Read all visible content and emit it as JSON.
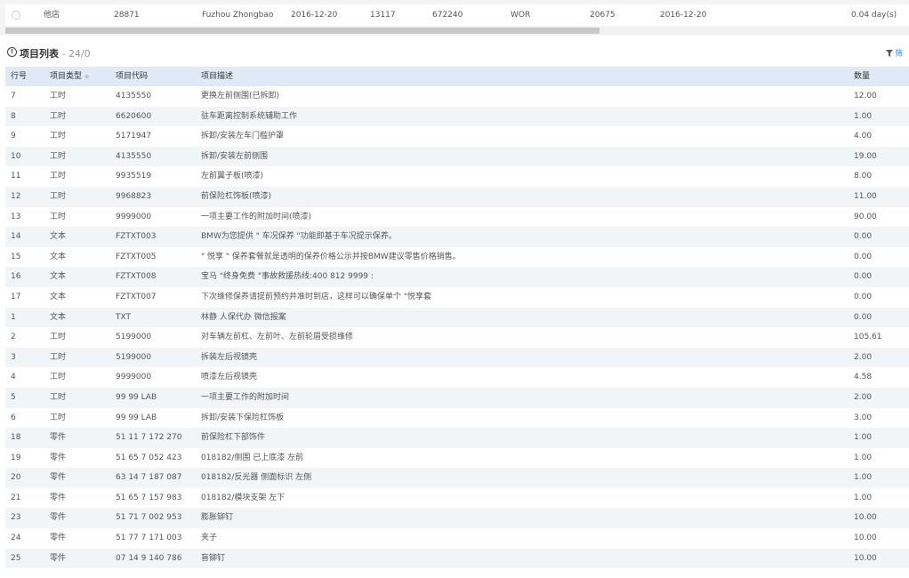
{
  "top_row": {
    "cells": [
      "他店",
      "28871",
      "Fuzhou Zhongbao",
      "2016-12-20",
      "13117",
      "672240",
      "WOR",
      "20675",
      "2016-12-20",
      "0.04 day(s)"
    ]
  },
  "section": {
    "title": "项目列表",
    "separator": " - ",
    "count": "24/0",
    "filter_label": "筛"
  },
  "table": {
    "headers": {
      "no": "行号",
      "type": "项目类型",
      "code": "项目代码",
      "desc": "项目描述",
      "qty": "数量"
    },
    "rows": [
      {
        "no": "7",
        "type": "工时",
        "code": "4135550",
        "desc": "更换左前侧围(已拆卸)",
        "qty": "12.00"
      },
      {
        "no": "8",
        "type": "工时",
        "code": "6620600",
        "desc": "驻车距离控制系统辅助工作",
        "qty": "1.00"
      },
      {
        "no": "9",
        "type": "工时",
        "code": "5171947",
        "desc": "拆卸/安装左车门槛护罩",
        "qty": "4.00"
      },
      {
        "no": "10",
        "type": "工时",
        "code": "4135550",
        "desc": "拆卸/安装左前侧围",
        "qty": "19.00"
      },
      {
        "no": "11",
        "type": "工时",
        "code": "9935519",
        "desc": "左前翼子板(喷漆)",
        "qty": "8.00"
      },
      {
        "no": "12",
        "type": "工时",
        "code": "9968823",
        "desc": "前保险杠饰板(喷漆)",
        "qty": "11.00"
      },
      {
        "no": "13",
        "type": "工时",
        "code": "9999000",
        "desc": "一项主要工作的附加时间(喷漆)",
        "qty": "90.00"
      },
      {
        "no": "14",
        "type": "文本",
        "code": "FZTXT003",
        "desc": "BMW为您提供 \" 车况保养 \"功能即基于车况提示保养。",
        "qty": "0.00"
      },
      {
        "no": "15",
        "type": "文本",
        "code": "FZTXT005",
        "desc": "\" 悦享 \" 保养套餐就是透明的保养价格公示并按BMW建议零售价格销售。",
        "qty": "0.00"
      },
      {
        "no": "16",
        "type": "文本",
        "code": "FZTXT008",
        "desc": "宝马 \"终身免费 \"事故救援热线:400 812 9999 :",
        "qty": "0.00"
      },
      {
        "no": "17",
        "type": "文本",
        "code": "FZTXT007",
        "desc": "下次维修保养请提前预约并准时到店，这样可以确保单个 \"悦享套",
        "qty": "0.00"
      },
      {
        "no": "1",
        "type": "文本",
        "code": "TXT",
        "desc": "林静 人保代办 微信报案",
        "qty": "0.00"
      },
      {
        "no": "2",
        "type": "工时",
        "code": "5199000",
        "desc": "对车辆左前杠、左前叶、左前轮眉受损维修",
        "qty": "105.61"
      },
      {
        "no": "3",
        "type": "工时",
        "code": "5199000",
        "desc": "拆装左后视镜壳",
        "qty": "2.00"
      },
      {
        "no": "4",
        "type": "工时",
        "code": "9999000",
        "desc": "喷漆左后视镜壳",
        "qty": "4.58"
      },
      {
        "no": "5",
        "type": "工时",
        "code": "99 99 LAB",
        "desc": "一项主要工作的附加时间",
        "qty": "2.00"
      },
      {
        "no": "6",
        "type": "工时",
        "code": "99 99 LAB",
        "desc": "拆卸/安装下保险杠饰板",
        "qty": "3.00"
      },
      {
        "no": "18",
        "type": "零件",
        "code": "51 11 7 172 270",
        "desc": "前保险杠下部饰件",
        "qty": "1.00"
      },
      {
        "no": "19",
        "type": "零件",
        "code": "51 65 7 052 423",
        "desc": "018182/侧围 已上底漆 左前",
        "qty": "1.00"
      },
      {
        "no": "20",
        "type": "零件",
        "code": "63 14 7 187 087",
        "desc": "018182/反光器 侧面标识 左侧",
        "qty": "1.00"
      },
      {
        "no": "21",
        "type": "零件",
        "code": "51 65 7 157 983",
        "desc": "018182/模块支架 左下",
        "qty": "1.00"
      },
      {
        "no": "23",
        "type": "零件",
        "code": "51 71 7 002 953",
        "desc": "膨胀铆钉",
        "qty": "10.00"
      },
      {
        "no": "24",
        "type": "零件",
        "code": "51 77 7 171 003",
        "desc": "夹子",
        "qty": "10.00"
      },
      {
        "no": "25",
        "type": "零件",
        "code": "07 14 9 140 786",
        "desc": "盲铆钉",
        "qty": "10.00"
      }
    ]
  },
  "colors": {
    "header_bg": "#dfeaf6",
    "stripe_bg": "#f2f5f8",
    "accent": "#3a8ee6"
  }
}
